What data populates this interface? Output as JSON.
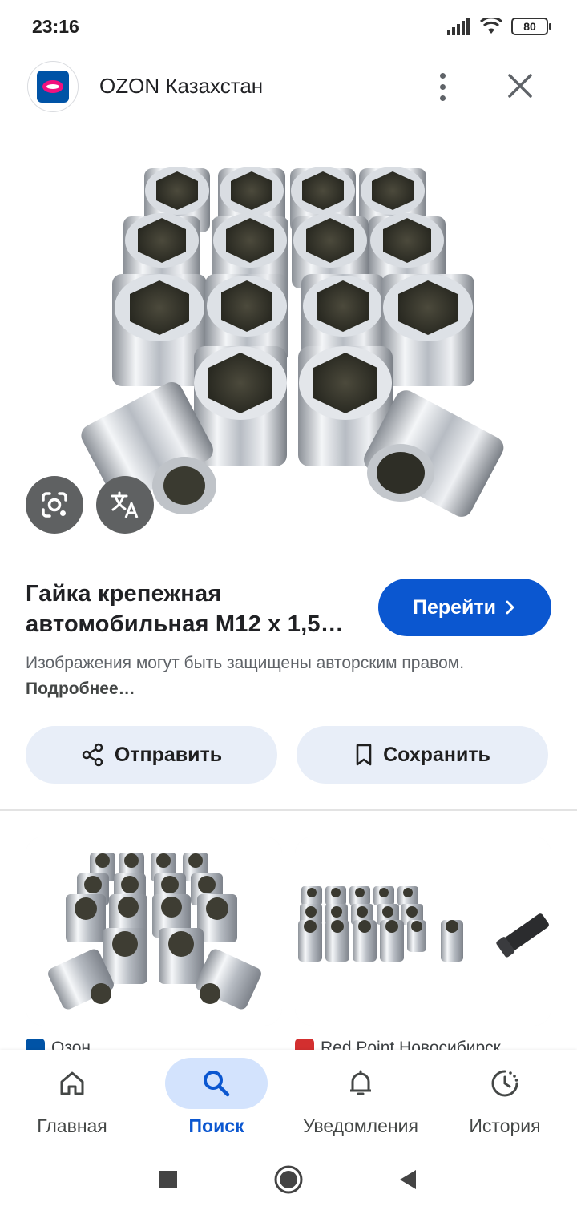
{
  "status_bar": {
    "time": "23:16",
    "battery": "80"
  },
  "header": {
    "site_title": "OZON Казахстан"
  },
  "product": {
    "title": "Гайка крепежная автомобильная M12 x 1,5…",
    "visit_label": "Перейти",
    "copyright_text": "Изображения могут быть защищены авторским правом.",
    "more_link": "Подробнее…"
  },
  "actions": {
    "share_label": "Отправить",
    "save_label": "Сохранить"
  },
  "related": [
    {
      "source": "Озон"
    },
    {
      "source": "Red Point Новосибирск"
    }
  ],
  "bottom_nav": [
    {
      "label": "Главная",
      "icon": "home-icon"
    },
    {
      "label": "Поиск",
      "icon": "search-icon",
      "active": true
    },
    {
      "label": "Уведомления",
      "icon": "bell-icon"
    },
    {
      "label": "История",
      "icon": "history-icon"
    }
  ],
  "colors": {
    "accent": "#0b57d0",
    "chip_bg": "#e8eef8",
    "active_nav_bg": "#d3e3fd"
  }
}
